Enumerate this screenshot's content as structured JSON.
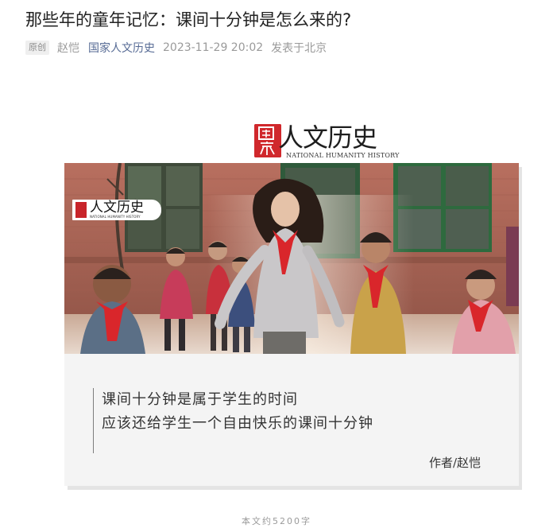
{
  "article": {
    "title": "那些年的童年记忆：课间十分钟是怎么来的?",
    "badge": "原创",
    "author": "赵恺",
    "account": "国家人文历史",
    "datetime": "2023-11-29 20:02",
    "location": "发表于北京",
    "word_count": "本文约5200字"
  },
  "logo": {
    "seal_chars": "国家",
    "name": "人文历史",
    "subtitle": "NATIONAL HUMANITY HISTORY"
  },
  "card": {
    "photo_logo_name": "人文历史",
    "photo_logo_sub": "NATIONAL HUMANITY HISTORY",
    "quote_line_1": "课间十分钟是属于学生的时间",
    "quote_line_2": "应该还给学生一个自由快乐的课间十分钟",
    "byline": "作者/赵恺"
  },
  "colors": {
    "account_link": "#576b95",
    "seal_red": "#d0282c",
    "scarf_red": "#d9262b"
  }
}
